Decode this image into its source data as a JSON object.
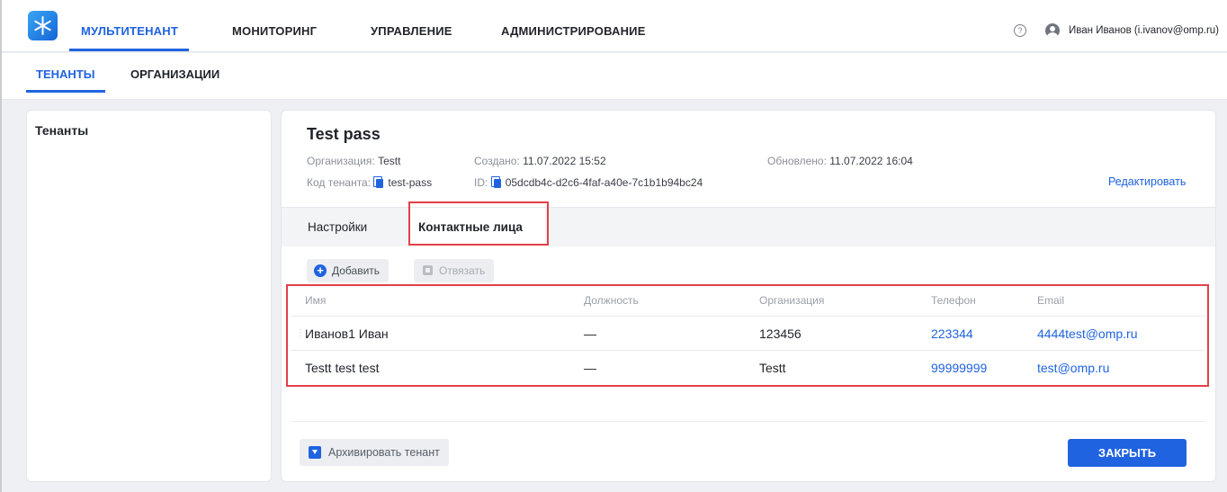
{
  "header": {
    "nav": [
      "МУЛЬТИТЕНАНТ",
      "МОНИТОРИНГ",
      "УПРАВЛЕНИЕ",
      "АДМИНИСТРИРОВАНИЕ"
    ],
    "help_symbol": "?",
    "user_name": "Иван Иванов (i.ivanov@omp.ru)"
  },
  "subtabs": [
    "ТЕНАНТЫ",
    "ОРГАНИЗАЦИИ"
  ],
  "sidebar": {
    "title": "Тенанты"
  },
  "tenant": {
    "title": "Test pass",
    "org_label": "Организация:",
    "org_value": "Testt",
    "created_label": "Создано:",
    "created_value": "11.07.2022 15:52",
    "updated_label": "Обновлено:",
    "updated_value": "11.07.2022 16:04",
    "code_label": "Код тенанта:",
    "code_value": "test-pass",
    "id_label": "ID:",
    "id_value": "05dcdb4c-d2c6-4faf-a40e-7c1b1b94bc24",
    "edit_label": "Редактировать"
  },
  "panel_tabs": [
    "Настройки",
    "Контактные лица"
  ],
  "toolbar": {
    "add_label": "Добавить",
    "unlink_label": "Отвязать"
  },
  "table": {
    "headers": [
      "Имя",
      "Должность",
      "Организация",
      "Телефон",
      "Email"
    ],
    "rows": [
      [
        "Иванов1 Иван",
        "—",
        "123456",
        "223344",
        "4444test@omp.ru"
      ],
      [
        "Testt test test",
        "—",
        "Testt",
        "99999999",
        "test@omp.ru"
      ]
    ]
  },
  "footer": {
    "archive_label": "Архивировать тенант",
    "close_label": "ЗАКРЫТЬ"
  },
  "colors": {
    "accent": "#1f63e0",
    "highlight": "#e2404a",
    "background": "#eef0f3"
  }
}
